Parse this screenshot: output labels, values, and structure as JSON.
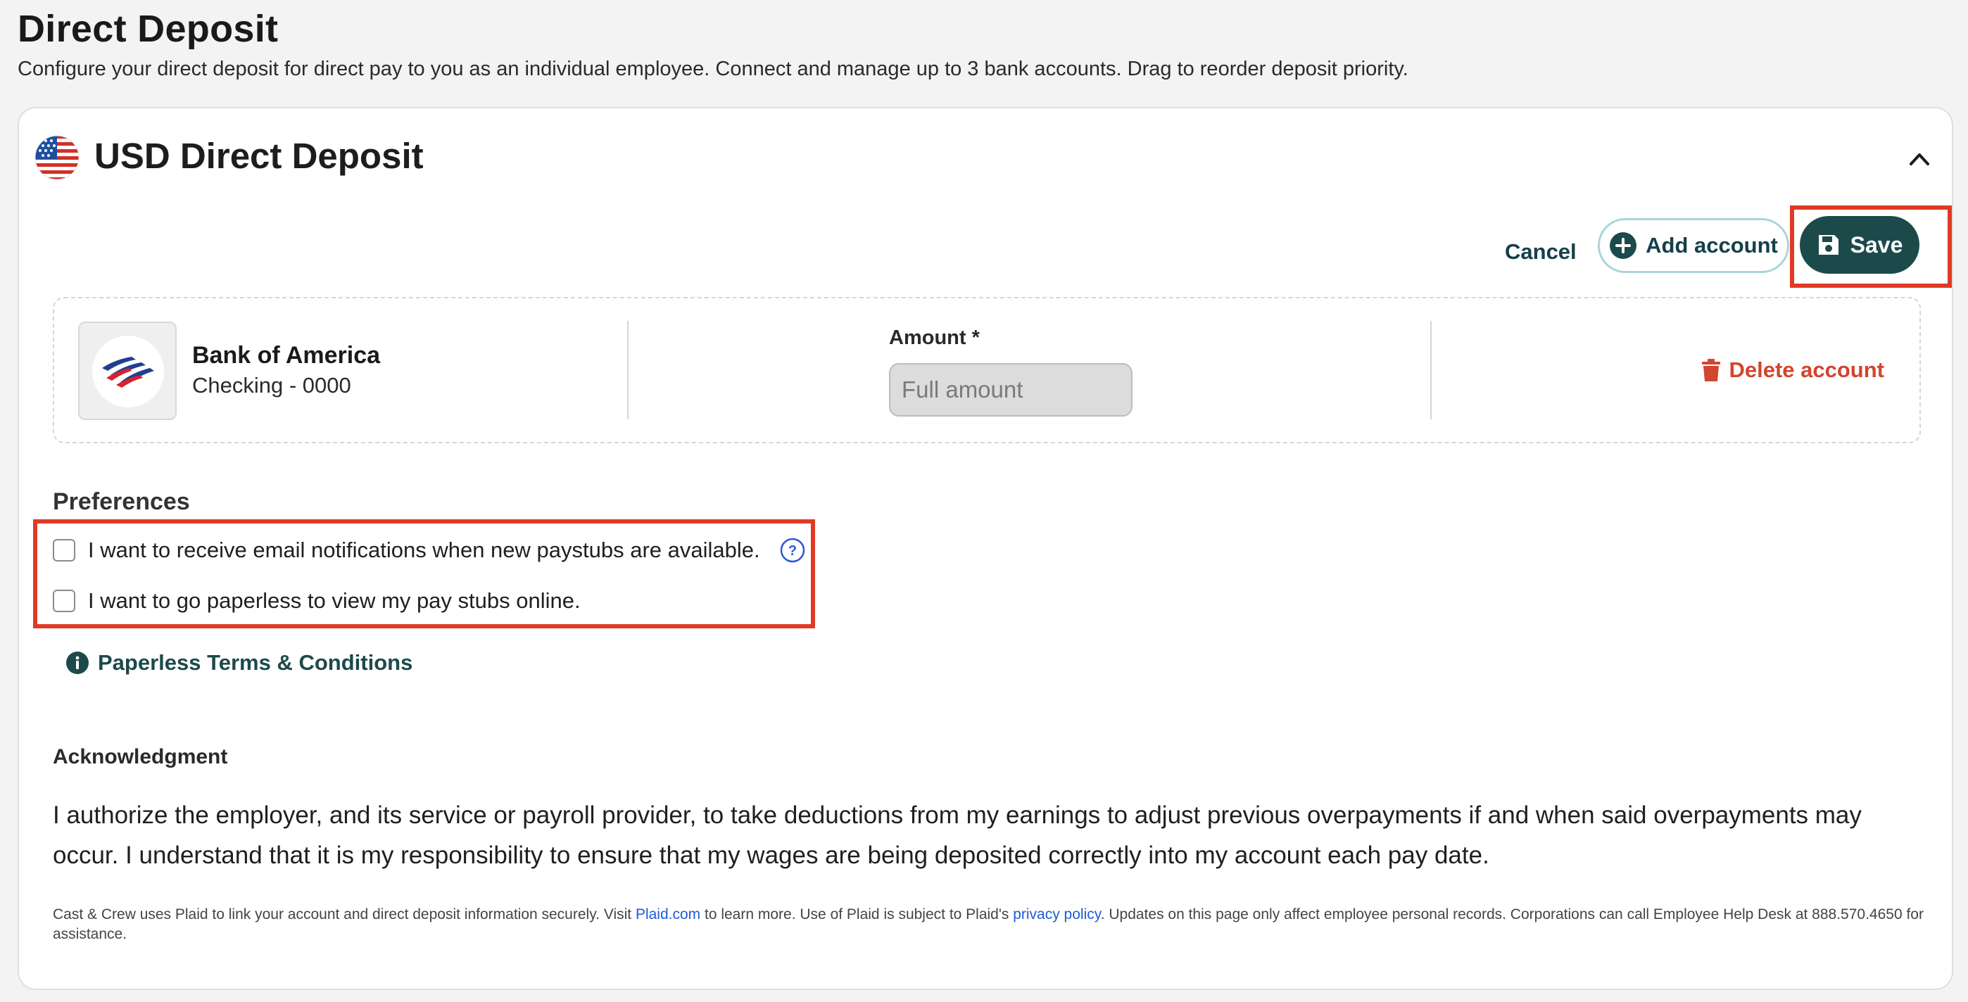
{
  "page": {
    "title": "Direct Deposit",
    "subtitle": "Configure your direct deposit for direct pay to you as an individual employee. Connect and manage up to 3 bank accounts. Drag to reorder deposit priority."
  },
  "card": {
    "title": "USD Direct Deposit",
    "flag_icon": "us-flag-icon",
    "collapse_icon": "chevron-up-icon"
  },
  "actions": {
    "cancel_label": "Cancel",
    "add_account_label": "Add account",
    "save_label": "Save"
  },
  "account": {
    "bank_name": "Bank of America",
    "account_type": "Checking - 0000",
    "amount_label": "Amount *",
    "amount_placeholder": "Full amount",
    "delete_label": "Delete account"
  },
  "preferences": {
    "heading": "Preferences",
    "items": [
      {
        "label": "I want to receive email notifications when new paystubs are available.",
        "checked": false,
        "has_help": true
      },
      {
        "label": "I want to go paperless to view my pay stubs online.",
        "checked": false,
        "has_help": false
      }
    ],
    "terms_link": "Paperless Terms & Conditions"
  },
  "acknowledgment": {
    "heading": "Acknowledgment",
    "text": "I authorize the employer, and its service or payroll provider, to take deductions from my earnings to adjust previous overpayments if and when said overpayments may occur. I understand that it is my responsibility to ensure that my wages are being deposited correctly into my account each pay date."
  },
  "footer": {
    "part1": "Cast & Crew uses Plaid to link your account and direct deposit information securely. Visit ",
    "plaid_link": "Plaid.com",
    "part2": " to learn more. Use of Plaid is subject to Plaid's ",
    "privacy_link": "privacy policy",
    "part3": ". Updates on this page only affect employee personal records. Corporations can call Employee Help Desk at 888.570.4650 for assistance."
  },
  "colors": {
    "primary": "#1c4a4a",
    "danger": "#d2452e",
    "highlight": "#e03a26",
    "link": "#1f5bd6"
  }
}
